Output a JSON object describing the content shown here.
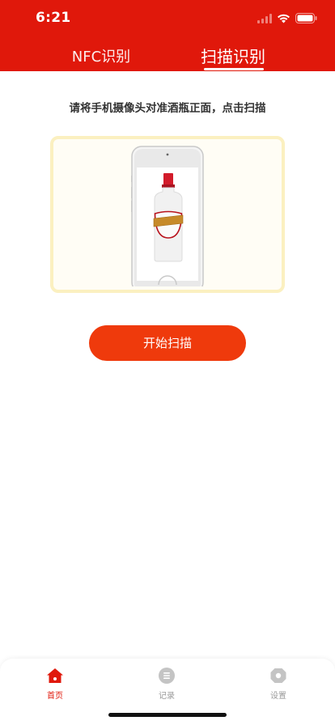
{
  "status_bar": {
    "time": "6:21",
    "icons": [
      "cellular-icon",
      "wifi-icon",
      "battery-icon"
    ]
  },
  "tabs": [
    {
      "label": "NFC识别",
      "active": false
    },
    {
      "label": "扫描识别",
      "active": true
    }
  ],
  "instruction": "请将手机摄像头对准酒瓶正面，点击扫描",
  "illustration": {
    "icon": "phone-with-bottle-illustration"
  },
  "scan_button": {
    "label": "开始扫描"
  },
  "tabbar": {
    "items": [
      {
        "label": "首页",
        "icon": "home-icon",
        "active": true
      },
      {
        "label": "记录",
        "icon": "list-icon",
        "active": false
      },
      {
        "label": "设置",
        "icon": "settings-icon",
        "active": false
      }
    ]
  },
  "colors": {
    "brand_red": "#e0180b",
    "button_red": "#ef3a0c",
    "illustration_border": "#fbf0c0",
    "inactive_gray": "#9a9a9a"
  }
}
